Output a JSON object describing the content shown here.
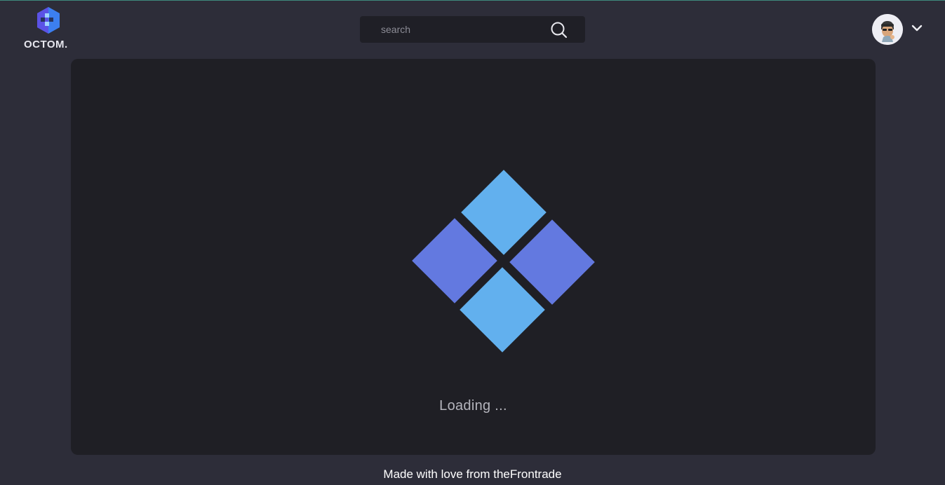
{
  "header": {
    "logo_text": "OCTOM.",
    "logo_icon": "octom-logo-icon",
    "search": {
      "placeholder": "search",
      "value": "",
      "icon": "search-icon"
    },
    "user_menu": {
      "avatar_icon": "avatar",
      "chevron_icon": "chevron-down-icon"
    }
  },
  "loader": {
    "text": "Loading ...",
    "colors": {
      "light": "#62b0ee",
      "dark": "#6379e0"
    }
  },
  "footer": {
    "text": "Made with love from theFrontrade"
  },
  "theme": {
    "background": "#2d2d39",
    "panel": "#1f1f25",
    "accent": "#3f8a7d"
  }
}
